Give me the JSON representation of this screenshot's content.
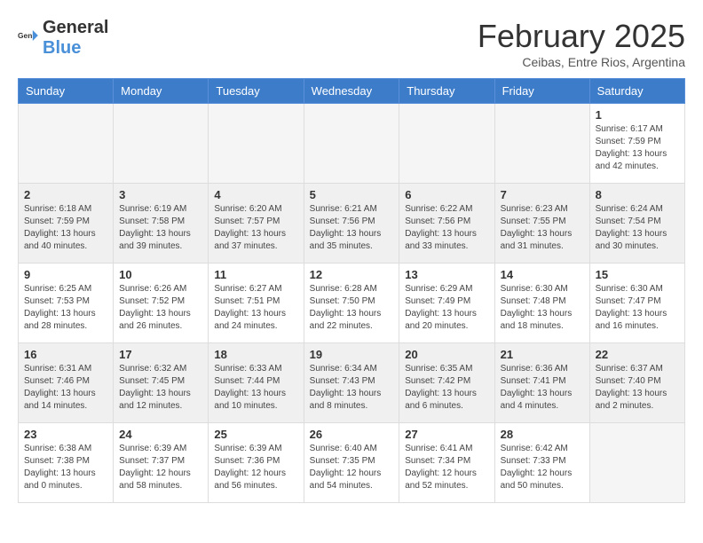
{
  "header": {
    "logo_general": "General",
    "logo_blue": "Blue",
    "title": "February 2025",
    "subtitle": "Ceibas, Entre Rios, Argentina"
  },
  "weekdays": [
    "Sunday",
    "Monday",
    "Tuesday",
    "Wednesday",
    "Thursday",
    "Friday",
    "Saturday"
  ],
  "weeks": [
    [
      {
        "day": "",
        "info": ""
      },
      {
        "day": "",
        "info": ""
      },
      {
        "day": "",
        "info": ""
      },
      {
        "day": "",
        "info": ""
      },
      {
        "day": "",
        "info": ""
      },
      {
        "day": "",
        "info": ""
      },
      {
        "day": "1",
        "info": "Sunrise: 6:17 AM\nSunset: 7:59 PM\nDaylight: 13 hours\nand 42 minutes."
      }
    ],
    [
      {
        "day": "2",
        "info": "Sunrise: 6:18 AM\nSunset: 7:59 PM\nDaylight: 13 hours\nand 40 minutes."
      },
      {
        "day": "3",
        "info": "Sunrise: 6:19 AM\nSunset: 7:58 PM\nDaylight: 13 hours\nand 39 minutes."
      },
      {
        "day": "4",
        "info": "Sunrise: 6:20 AM\nSunset: 7:57 PM\nDaylight: 13 hours\nand 37 minutes."
      },
      {
        "day": "5",
        "info": "Sunrise: 6:21 AM\nSunset: 7:56 PM\nDaylight: 13 hours\nand 35 minutes."
      },
      {
        "day": "6",
        "info": "Sunrise: 6:22 AM\nSunset: 7:56 PM\nDaylight: 13 hours\nand 33 minutes."
      },
      {
        "day": "7",
        "info": "Sunrise: 6:23 AM\nSunset: 7:55 PM\nDaylight: 13 hours\nand 31 minutes."
      },
      {
        "day": "8",
        "info": "Sunrise: 6:24 AM\nSunset: 7:54 PM\nDaylight: 13 hours\nand 30 minutes."
      }
    ],
    [
      {
        "day": "9",
        "info": "Sunrise: 6:25 AM\nSunset: 7:53 PM\nDaylight: 13 hours\nand 28 minutes."
      },
      {
        "day": "10",
        "info": "Sunrise: 6:26 AM\nSunset: 7:52 PM\nDaylight: 13 hours\nand 26 minutes."
      },
      {
        "day": "11",
        "info": "Sunrise: 6:27 AM\nSunset: 7:51 PM\nDaylight: 13 hours\nand 24 minutes."
      },
      {
        "day": "12",
        "info": "Sunrise: 6:28 AM\nSunset: 7:50 PM\nDaylight: 13 hours\nand 22 minutes."
      },
      {
        "day": "13",
        "info": "Sunrise: 6:29 AM\nSunset: 7:49 PM\nDaylight: 13 hours\nand 20 minutes."
      },
      {
        "day": "14",
        "info": "Sunrise: 6:30 AM\nSunset: 7:48 PM\nDaylight: 13 hours\nand 18 minutes."
      },
      {
        "day": "15",
        "info": "Sunrise: 6:30 AM\nSunset: 7:47 PM\nDaylight: 13 hours\nand 16 minutes."
      }
    ],
    [
      {
        "day": "16",
        "info": "Sunrise: 6:31 AM\nSunset: 7:46 PM\nDaylight: 13 hours\nand 14 minutes."
      },
      {
        "day": "17",
        "info": "Sunrise: 6:32 AM\nSunset: 7:45 PM\nDaylight: 13 hours\nand 12 minutes."
      },
      {
        "day": "18",
        "info": "Sunrise: 6:33 AM\nSunset: 7:44 PM\nDaylight: 13 hours\nand 10 minutes."
      },
      {
        "day": "19",
        "info": "Sunrise: 6:34 AM\nSunset: 7:43 PM\nDaylight: 13 hours\nand 8 minutes."
      },
      {
        "day": "20",
        "info": "Sunrise: 6:35 AM\nSunset: 7:42 PM\nDaylight: 13 hours\nand 6 minutes."
      },
      {
        "day": "21",
        "info": "Sunrise: 6:36 AM\nSunset: 7:41 PM\nDaylight: 13 hours\nand 4 minutes."
      },
      {
        "day": "22",
        "info": "Sunrise: 6:37 AM\nSunset: 7:40 PM\nDaylight: 13 hours\nand 2 minutes."
      }
    ],
    [
      {
        "day": "23",
        "info": "Sunrise: 6:38 AM\nSunset: 7:38 PM\nDaylight: 13 hours\nand 0 minutes."
      },
      {
        "day": "24",
        "info": "Sunrise: 6:39 AM\nSunset: 7:37 PM\nDaylight: 12 hours\nand 58 minutes."
      },
      {
        "day": "25",
        "info": "Sunrise: 6:39 AM\nSunset: 7:36 PM\nDaylight: 12 hours\nand 56 minutes."
      },
      {
        "day": "26",
        "info": "Sunrise: 6:40 AM\nSunset: 7:35 PM\nDaylight: 12 hours\nand 54 minutes."
      },
      {
        "day": "27",
        "info": "Sunrise: 6:41 AM\nSunset: 7:34 PM\nDaylight: 12 hours\nand 52 minutes."
      },
      {
        "day": "28",
        "info": "Sunrise: 6:42 AM\nSunset: 7:33 PM\nDaylight: 12 hours\nand 50 minutes."
      },
      {
        "day": "",
        "info": ""
      }
    ]
  ]
}
